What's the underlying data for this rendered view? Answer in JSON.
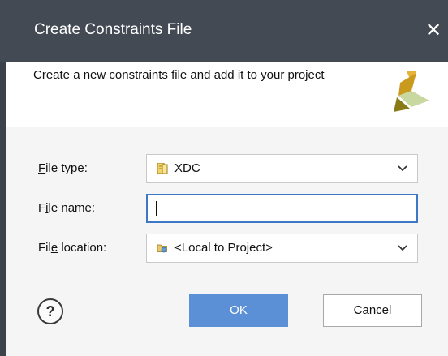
{
  "window": {
    "title": "Create Constraints File",
    "close_glyph": "✕"
  },
  "header": {
    "description": "Create a new constraints file and add it to your project",
    "logo_icon": "xilinx-logo-icon"
  },
  "form": {
    "file_type": {
      "label_pre": "",
      "label_mnemonic": "F",
      "label_post": "ile type:",
      "value": "XDC",
      "icon": "xdc-file-icon"
    },
    "file_name": {
      "label_pre": "F",
      "label_mnemonic": "i",
      "label_post": "le name:",
      "value": ""
    },
    "file_location": {
      "label_pre": "Fil",
      "label_mnemonic": "e",
      "label_post": " location:",
      "value": "<Local to Project>",
      "icon": "folder-icon"
    }
  },
  "buttons": {
    "help": "?",
    "ok": "OK",
    "cancel": "Cancel"
  },
  "colors": {
    "titlebar": "#434a54",
    "ok_button": "#5b8fd6",
    "focus_border": "#3d78c8"
  }
}
